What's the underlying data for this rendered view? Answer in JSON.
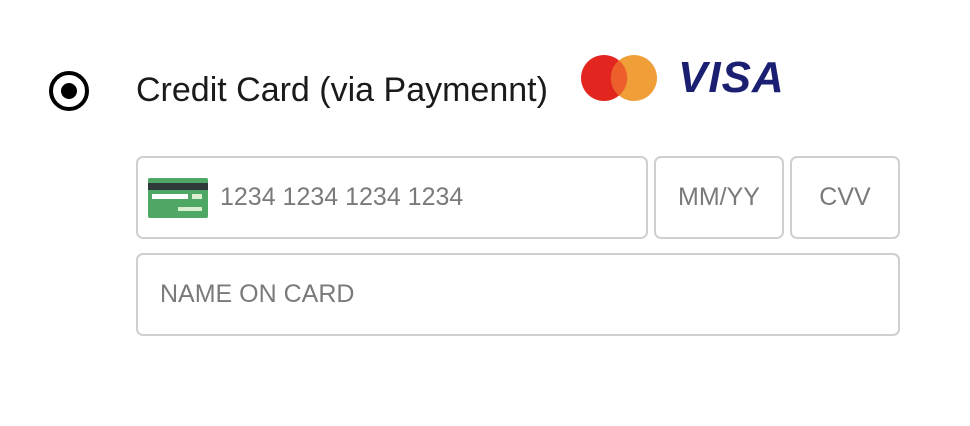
{
  "payment_method": {
    "label": "Credit Card (via Paymennt)",
    "selected": true
  },
  "brands": {
    "mastercard": {
      "icon": "mastercard-logo",
      "colors": {
        "left": "#e2261f",
        "right": "#f09e37",
        "overlap": "#ed5f2a"
      }
    },
    "visa": {
      "text": "VISA",
      "color": "#1a1f71"
    }
  },
  "form": {
    "card_number": {
      "icon": "credit-card-icon",
      "value": "",
      "placeholder": "1234 1234 1234 1234"
    },
    "expiry": {
      "value": "",
      "placeholder": "MM/YY"
    },
    "cvv": {
      "value": "",
      "placeholder": "CVV"
    },
    "name_on_card": {
      "value": "",
      "placeholder": "NAME ON CARD"
    }
  },
  "colors": {
    "field_border": "#cfcfcf",
    "placeholder": "#7a7a7a",
    "card_icon_green": "#4ea764",
    "card_icon_stripe": "#2f3b3a"
  }
}
